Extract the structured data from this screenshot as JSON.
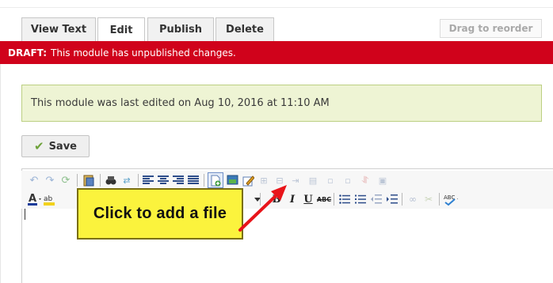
{
  "tabs": [
    {
      "label": "View Text"
    },
    {
      "label": "Edit"
    },
    {
      "label": "Publish"
    },
    {
      "label": "Delete"
    }
  ],
  "drag_label": "Drag to reorder",
  "draft": {
    "prefix": "DRAFT:",
    "message": "This module has unpublished changes."
  },
  "notice": "This module was last edited on Aug 10, 2016 at 11:10 AM",
  "save_label": "Save",
  "callout": "Click to add a file",
  "toolbar": {
    "row1": [
      "undo-icon",
      "redo-icon",
      "refresh-icon",
      "paste-icon",
      "find-icon",
      "replace-icon",
      "align-left-icon",
      "align-center-icon",
      "align-right-icon",
      "justify-icon",
      "add-file-icon",
      "insert-image-icon",
      "edit-icon",
      "table-icon",
      "table-row-icon",
      "table-col-icon",
      "table-cell-icon",
      "subscript-icon",
      "superscript-icon",
      "merge-icon",
      "split-icon"
    ],
    "row2": [
      "font-color-icon",
      "highlight-icon",
      "bold-icon",
      "italic-icon",
      "underline-icon",
      "strikethrough-icon",
      "bullet-list-icon",
      "number-list-icon",
      "outdent-icon",
      "indent-icon",
      "link-icon",
      "unlink-icon",
      "spellcheck-icon"
    ]
  },
  "colors": {
    "draft_red": "#d0021b",
    "notice_bg": "#eef4d4",
    "callout_yellow": "#fbf33d",
    "arrow_red": "#e8141a"
  }
}
